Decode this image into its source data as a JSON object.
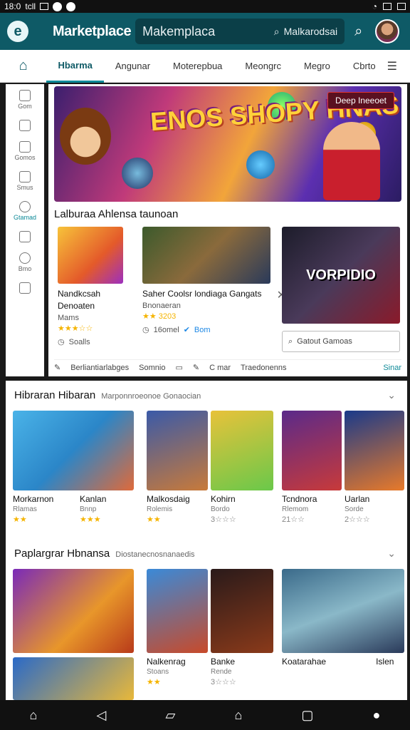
{
  "status": {
    "time": "18:0",
    "left_text": "tcll"
  },
  "header": {
    "title": "Marketplace",
    "search_value": "Makemplaca",
    "search_query": "Malkarodsai"
  },
  "tabs": [
    "Hbarma",
    "Angunar",
    "Moterepbua",
    "Meongrc",
    "Megro",
    "Cbrto"
  ],
  "sidebar": [
    {
      "label": "Gom",
      "icon": "home-icon"
    },
    {
      "label": "",
      "icon": "calendar-icon"
    },
    {
      "label": "Gomos",
      "icon": "monitor-icon"
    },
    {
      "label": "Smus",
      "icon": "people-icon"
    },
    {
      "label": "Gtamad",
      "icon": "clock-icon"
    },
    {
      "label": "",
      "icon": "image-icon"
    },
    {
      "label": "Bmo",
      "icon": "chat-icon"
    },
    {
      "label": "",
      "icon": "grid-icon"
    }
  ],
  "banner": {
    "title": "ENOS SHOPY HNAS",
    "cta": "Deep Ineeoet"
  },
  "featured": {
    "section_label": "Lalburaa Ahlensa taunoan",
    "cards": [
      {
        "name": "Nandkcsah Denoaten",
        "sub": "Mams",
        "rating": "★★★☆☆",
        "meta": "Soalls"
      },
      {
        "name": "Saher Coolsr londiaga Gangats",
        "sub": "Bnonaeran",
        "rating": "★★ 3203",
        "meta": "16omel",
        "meta2": "Bom"
      },
      {
        "name": "VORPIDIO",
        "sub": "",
        "rating": "",
        "meta": ""
      }
    ],
    "side_search_placeholder": "Gatout Gamoas",
    "bottom_row": [
      "Berliantiarlabges",
      "Somnio",
      "",
      "C mar",
      "Traedonenns",
      "Sinar"
    ]
  },
  "sections": [
    {
      "title": "Hibraran Hibaran",
      "subtitle": "Marponnroeonoe Gonaocian",
      "tiles": [
        {
          "name": "Morkarnon",
          "sub": "Rlamas",
          "rating": "★★"
        },
        {
          "name": "Kanlan",
          "sub": "Bnnp",
          "rating": "★★★"
        },
        {
          "name": "Malkosdaig",
          "sub": "Rolemis",
          "rating": "★★"
        },
        {
          "name": "Kohirn",
          "sub": "Bordo",
          "rating": "3☆☆☆"
        },
        {
          "name": "Tcndnora",
          "sub": "Rlemom",
          "rating": "21☆☆"
        },
        {
          "name": "Uarlan",
          "sub": "Sorde",
          "rating": "2☆☆☆"
        }
      ]
    },
    {
      "title": "Paplargrar Hbnansa",
      "subtitle": "Diostanecnosnanaedis",
      "tiles": [
        {
          "name": "",
          "sub": "",
          "rating": ""
        },
        {
          "name": "Nalkenrag",
          "sub": "Stoans",
          "rating": "★★"
        },
        {
          "name": "Banke",
          "sub": "Rende",
          "rating": "3☆☆☆"
        },
        {
          "name": "Koatarahae",
          "sub": "",
          "rating": ""
        },
        {
          "name": "Islen",
          "sub": "",
          "rating": ""
        }
      ]
    }
  ],
  "colors": {
    "primary": "#0e5a66",
    "accent": "#0e8a98",
    "star": "#f5b400"
  }
}
